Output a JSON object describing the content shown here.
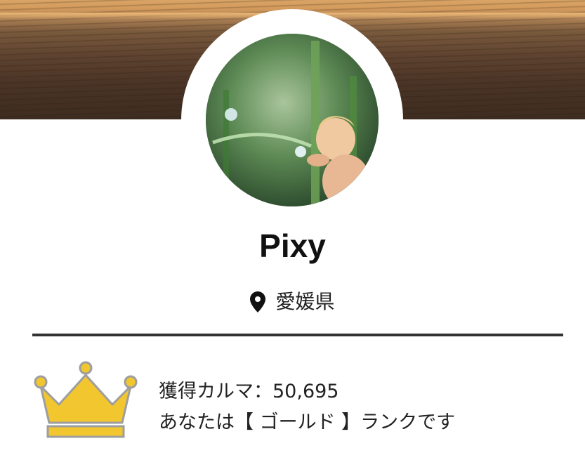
{
  "profile": {
    "username": "Pixy",
    "location": "愛媛県"
  },
  "icons": {
    "location": "map-pin-icon",
    "rank": "crown-icon"
  },
  "karma": {
    "label": "獲得カルマ：",
    "value": "50,695",
    "rank_sentence": "あなたは【 ゴールド 】ランクです"
  },
  "colors": {
    "crown_fill": "#F2C62F",
    "crown_stroke": "#9E9E9E",
    "divider": "#333333"
  }
}
